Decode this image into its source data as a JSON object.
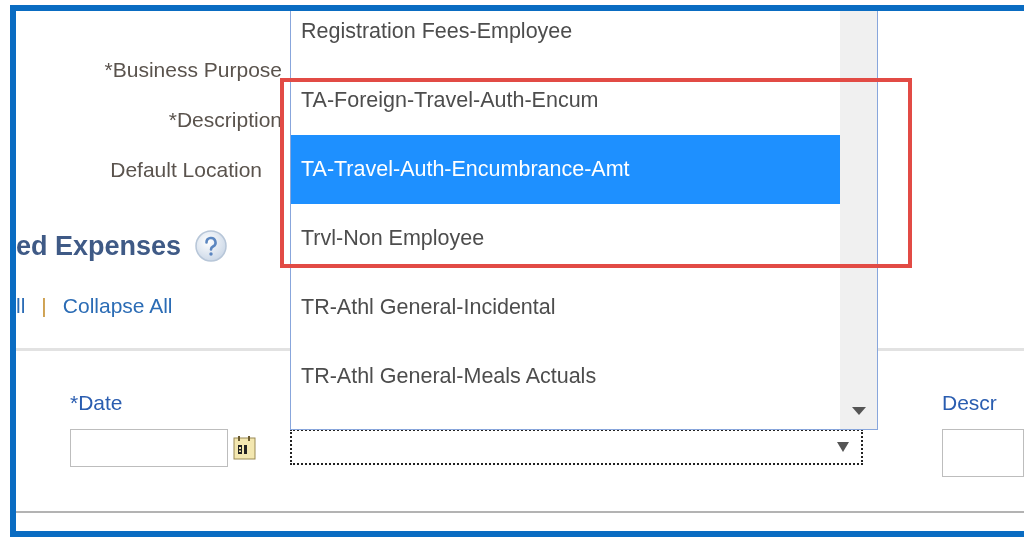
{
  "form": {
    "fields": [
      {
        "label": "*Business Purpose"
      },
      {
        "label": "*Description"
      },
      {
        "label": "Default Location"
      }
    ]
  },
  "section": {
    "title": "ed Expenses",
    "links": [
      "ll",
      "Collapse All"
    ],
    "separator": "|"
  },
  "expense_line": {
    "date_label": "*Date",
    "description_label": "Descr"
  },
  "dropdown": {
    "options": [
      {
        "label": "Registration Fees-Employee",
        "selected": false
      },
      {
        "label": "TA-Foreign-Travel-Auth-Encum",
        "selected": false
      },
      {
        "label": "TA-Travel-Auth-Encumbrance-Amt",
        "selected": true
      },
      {
        "label": "Trvl-Non Employee",
        "selected": false
      },
      {
        "label": "TR-Athl General-Incidental",
        "selected": false
      },
      {
        "label": "TR-Athl General-Meals Actuals",
        "selected": false
      }
    ]
  }
}
